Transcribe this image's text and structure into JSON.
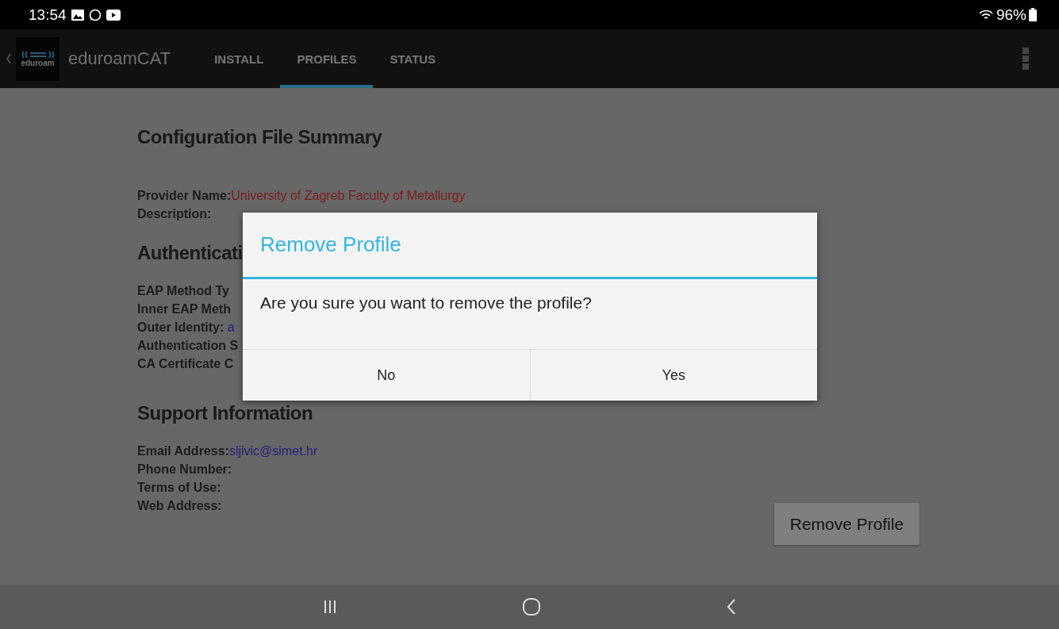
{
  "status_bar": {
    "time": "13:54",
    "battery": "96%"
  },
  "app_bar": {
    "logo_text": "eduroam",
    "title": "eduroamCAT",
    "tabs": [
      {
        "label": "INSTALL",
        "selected": false
      },
      {
        "label": "PROFILES",
        "selected": true
      },
      {
        "label": "STATUS",
        "selected": false
      }
    ]
  },
  "sections": [
    {
      "heading": "Configuration File Summary",
      "fields": [
        {
          "label": "Provider Name:",
          "value": "University of Zagreb Faculty of Metallurgy",
          "kind": "name"
        },
        {
          "label": "Description:"
        }
      ]
    },
    {
      "heading": "Authenticati",
      "fields": [
        {
          "label": "EAP Method Ty"
        },
        {
          "label": "Inner EAP Meth"
        },
        {
          "label": "Outer Identity: ",
          "value": "a",
          "kind": "link"
        },
        {
          "label": "Authentication S"
        },
        {
          "label": "CA Certificate C"
        }
      ]
    },
    {
      "heading": "Support Information",
      "fields": [
        {
          "label": "Email Address:",
          "value": "sljivic@simet.hr",
          "kind": "link"
        },
        {
          "label": "Phone Number:"
        },
        {
          "label": "Terms of Use:"
        },
        {
          "label": "Web Address:"
        }
      ]
    }
  ],
  "remove_button": "Remove Profile",
  "dialog": {
    "title": "Remove Profile",
    "message": "Are you sure you want to remove the profile?",
    "buttons": [
      "No",
      "Yes"
    ]
  }
}
